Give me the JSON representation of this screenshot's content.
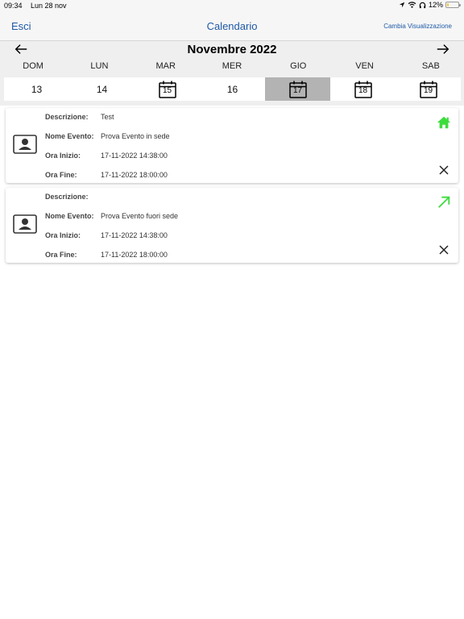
{
  "status_bar": {
    "time": "09:34",
    "date": "Lun 28 nov",
    "battery": "12%",
    "battery_level": 0.12
  },
  "nav": {
    "left_button": "Esci",
    "title": "Calendario",
    "right_button": "Cambia Visualizzazione"
  },
  "calendar": {
    "month": "Novembre 2022",
    "weekdays": [
      "DOM",
      "LUN",
      "MAR",
      "MER",
      "GIO",
      "VEN",
      "SAB"
    ],
    "days": [
      {
        "num": "13",
        "has_event": false,
        "selected": false
      },
      {
        "num": "14",
        "has_event": false,
        "selected": false
      },
      {
        "num": "15",
        "has_event": true,
        "selected": false
      },
      {
        "num": "16",
        "has_event": false,
        "selected": false
      },
      {
        "num": "17",
        "has_event": true,
        "selected": true
      },
      {
        "num": "18",
        "has_event": true,
        "selected": false
      },
      {
        "num": "19",
        "has_event": true,
        "selected": false
      }
    ]
  },
  "labels": {
    "descrizione": "Descrizione:",
    "nome_evento": "Nome Evento:",
    "ora_inizio": "Ora Inizio:",
    "ora_fine": "Ora Fine:"
  },
  "events": [
    {
      "descrizione": "Test",
      "nome_evento": "Prova Evento in sede",
      "ora_inizio": "17-11-2022 14:38:00",
      "ora_fine": "17-11-2022 18:00:00",
      "type_icon": "home-icon",
      "icon_color": "#3ddc3d"
    },
    {
      "descrizione": "",
      "nome_evento": "Prova Evento fuori sede",
      "ora_inizio": "17-11-2022 14:38:00",
      "ora_fine": "17-11-2022 18:00:00",
      "type_icon": "arrow-up-right-icon",
      "icon_color": "#3ddc3d"
    }
  ],
  "colors": {
    "accent": "#1f5aa6",
    "selected_day": "#b3b3b3",
    "event_icon": "#3ddc3d"
  }
}
